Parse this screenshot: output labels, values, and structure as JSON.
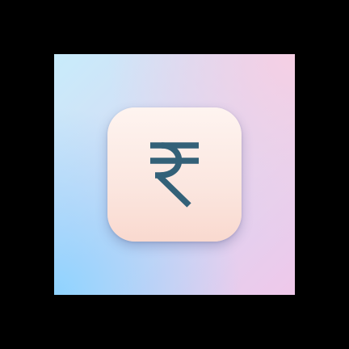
{
  "app_icon": {
    "icon": "rupee-icon",
    "glyph_color": "#336178",
    "tile_top_color": "#fef4f0",
    "tile_bottom_color": "#f9d9cf"
  },
  "backdrop": {
    "colors": [
      "#8fd3ff",
      "#d9d8f3",
      "#f6cfe4"
    ]
  }
}
